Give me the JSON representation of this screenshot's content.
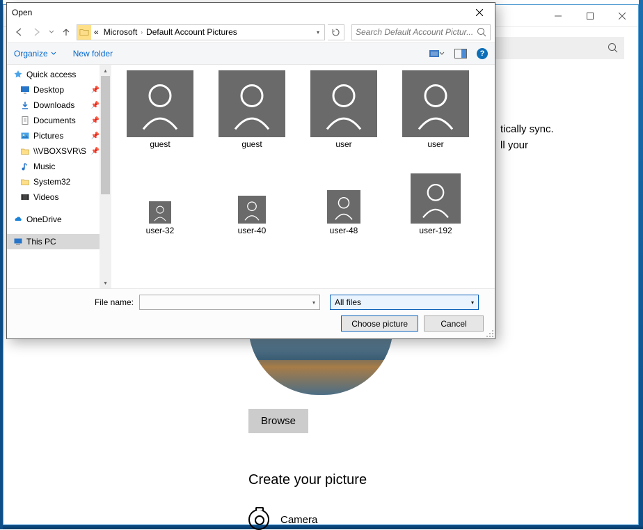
{
  "settings": {
    "body_text_1": "tically sync.",
    "body_text_2": "ll your",
    "browse_label": "Browse",
    "create_heading": "Create your picture",
    "camera_label": "Camera"
  },
  "dialog": {
    "title": "Open",
    "breadcrumb": {
      "seg1": "Microsoft",
      "seg2": "Default Account Pictures"
    },
    "search_placeholder": "Search Default Account Pictur...",
    "toolbar": {
      "organize": "Organize",
      "newfolder": "New folder"
    },
    "tree": {
      "quickaccess": "Quick access",
      "desktop": "Desktop",
      "downloads": "Downloads",
      "documents": "Documents",
      "pictures": "Pictures",
      "vbox": "\\\\VBOXSVR\\S",
      "music": "Music",
      "system32": "System32",
      "videos": "Videos",
      "onedrive": "OneDrive",
      "thispc": "This PC"
    },
    "files": [
      {
        "name": "guest",
        "size": 96
      },
      {
        "name": "guest",
        "size": 96
      },
      {
        "name": "user",
        "size": 96
      },
      {
        "name": "user",
        "size": 96
      },
      {
        "name": "user-32",
        "size": 32
      },
      {
        "name": "user-40",
        "size": 40
      },
      {
        "name": "user-48",
        "size": 48
      },
      {
        "name": "user-192",
        "size": 72
      }
    ],
    "filename_label": "File name:",
    "filter": "All files",
    "choose": "Choose picture",
    "cancel": "Cancel"
  }
}
